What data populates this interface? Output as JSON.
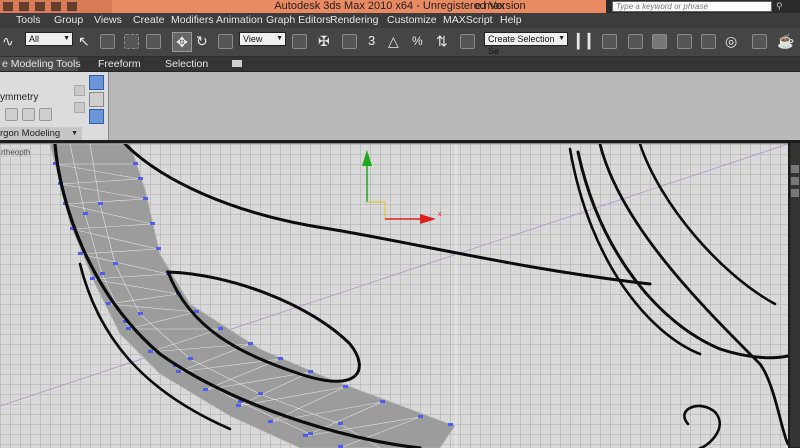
{
  "window": {
    "title": "Autodesk 3ds Max  2010 x64  - Unregistered Version",
    "file": "e.max"
  },
  "help_search": {
    "placeholder": "Type a keyword or phrase"
  },
  "menu": [
    "Tools",
    "Group",
    "Views",
    "Create",
    "Modifiers",
    "Animation",
    "Graph Editors",
    "Rendering",
    "Customize",
    "MAXScript",
    "Help"
  ],
  "toolbar": {
    "selection_filter": "All",
    "reference_coord": "View",
    "named_selection": "Create Selection Se",
    "snap_label": "3",
    "angle_snap_label": "%"
  },
  "ribbon": {
    "tabs": [
      "e Modeling Tools",
      "Freeform",
      "Selection"
    ],
    "symmetry_label": "ymmetry",
    "polymod_label": "rgon Modeling"
  },
  "viewport": {
    "label": "rtheopth",
    "gizmo_axis_x": "x",
    "grid_color": "#9a9a9a",
    "background": "#d9d9d9",
    "mesh_fill": "#9c9c9c",
    "vertex_color": "#4f5cf0",
    "axis_x_color": "#e02020",
    "axis_y_color": "#1ea81e"
  }
}
